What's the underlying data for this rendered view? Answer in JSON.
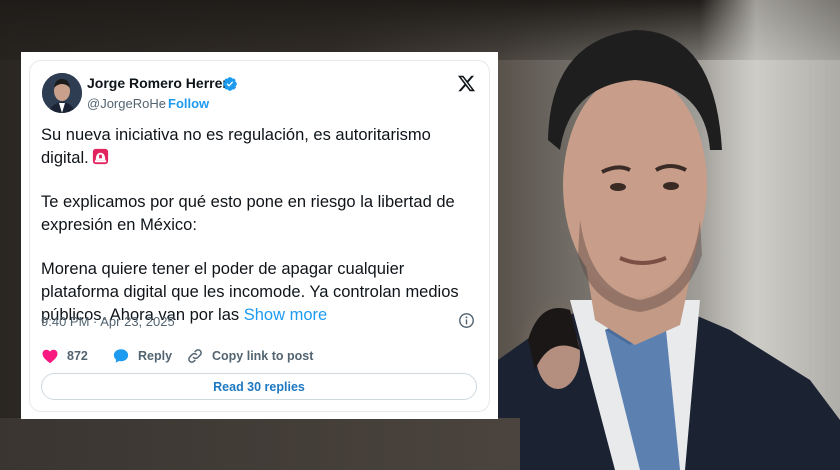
{
  "tweet": {
    "author_name": "Jorge Romero Herrera",
    "handle": "@JorgeRoHe",
    "separator": "·",
    "follow_label": "Follow",
    "paragraph_1": "Su nueva iniciativa no es regulación, es autoritarismo digital.",
    "paragraph_2": "Te explicamos por qué esto pone en riesgo la libertad de expresión en México:",
    "paragraph_3": "Morena quiere tener el poder de apagar cualquier plataforma digital que les incomode. Ya controlan medios públicos. Ahora van por las",
    "show_more_label": "Show more",
    "timestamp": "9:40 PM · Apr 23, 2025",
    "like_count": "872",
    "reply_label": "Reply",
    "copy_link_label": "Copy link to post",
    "read_replies_label": "Read 30 replies"
  },
  "icons": {
    "verified": "verified-badge-icon",
    "x_logo": "x-logo-icon",
    "siren": "police-siren-emoji",
    "info": "info-icon",
    "like": "heart-icon",
    "reply": "speech-bubble-icon",
    "copy_link": "link-icon"
  },
  "colors": {
    "accent": "#1d9bf0",
    "like": "#f91880",
    "text": "#0f1419",
    "secondary": "#536471",
    "siren": "#e0245e"
  }
}
